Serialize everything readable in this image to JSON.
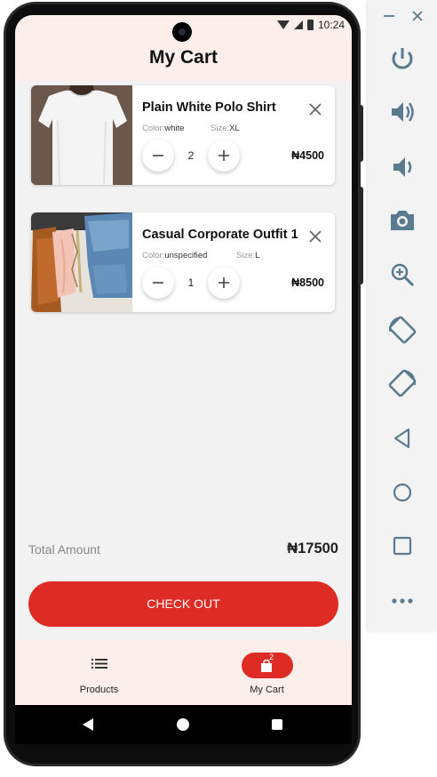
{
  "statusbar": {
    "time": "10:24"
  },
  "header": {
    "title": "My Cart"
  },
  "cart": {
    "items": [
      {
        "name": "Plain White Polo Shirt",
        "color_label": "Color:",
        "color_value": "white",
        "size_label": "Size:",
        "size_value": "XL",
        "quantity": "2",
        "price": "₦4500"
      },
      {
        "name": "Casual Corporate Outfit 1",
        "color_label": "Color:",
        "color_value": "unspecified",
        "size_label": "Size:",
        "size_value": "L",
        "quantity": "1",
        "price": "₦8500"
      }
    ]
  },
  "summary": {
    "total_label": "Total Amount",
    "total_value": "₦17500"
  },
  "checkout": {
    "label": "CHECK OUT"
  },
  "bottom_nav": {
    "items": [
      {
        "label": "Products",
        "icon": "list-icon"
      },
      {
        "label": "My Cart",
        "icon": "shopping-bag-icon",
        "badge": "2",
        "active": true
      }
    ]
  },
  "emulator_controls": {
    "icons": [
      "minimize-icon",
      "close-icon",
      "power-icon",
      "volume-up-icon",
      "volume-down-icon",
      "camera-icon",
      "zoom-icon",
      "rotate-left-icon",
      "rotate-right-icon",
      "back-icon",
      "home-icon",
      "overview-icon",
      "more-icon"
    ]
  },
  "colors": {
    "accent": "#de2b24",
    "header_bg": "#fcefea",
    "background": "#f2f2f2",
    "emulator_icon": "#5a7a90"
  }
}
